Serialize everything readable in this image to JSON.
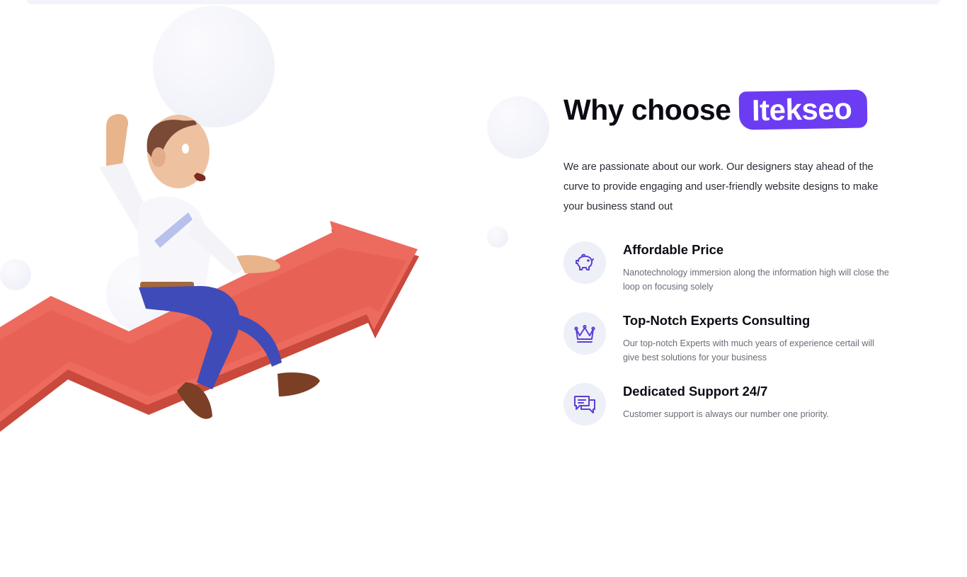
{
  "colors": {
    "accent": "#6c3cf2",
    "heading": "#0b0b14",
    "body_text": "#2b2b36",
    "muted_text": "#6b6b78",
    "icon_bg": "#eef0f8",
    "arrow": "#ec6b5e"
  },
  "hero": {
    "illustration": "3d-man-riding-red-arrow"
  },
  "section": {
    "heading_prefix": "Why choose",
    "heading_brand": "Itekseo",
    "intro": "We are passionate about our work. Our designers stay ahead of the curve to provide engaging and user-friendly website designs to make your business stand out"
  },
  "features": [
    {
      "icon": "piggy-bank-icon",
      "title": "Affordable Price",
      "description": "Nanotechnology immersion along the information high will close the loop on focusing solely"
    },
    {
      "icon": "crown-icon",
      "title": "Top-Notch Experts Consulting",
      "description": "Our top-notch Experts with much years of experience certail will give best solutions for your business"
    },
    {
      "icon": "chat-bubbles-icon",
      "title": "Dedicated Support 24/7",
      "description": "Customer support is always our number one priority."
    }
  ]
}
